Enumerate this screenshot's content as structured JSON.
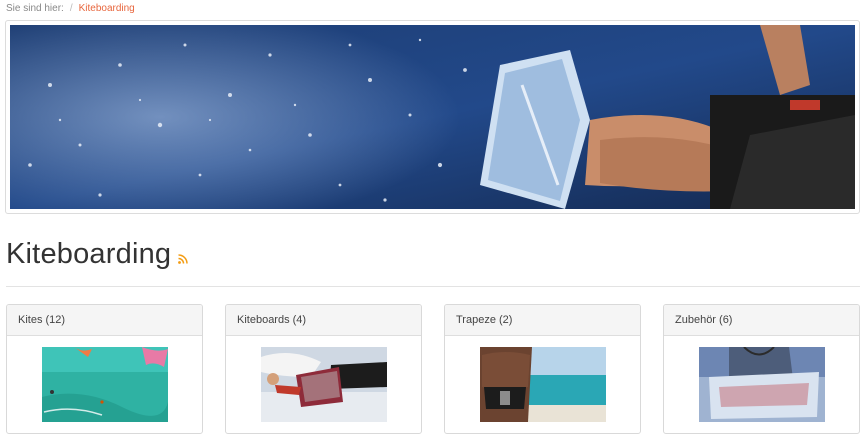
{
  "breadcrumb": {
    "prefix": "Sie sind hier:",
    "separator": "/",
    "current": "Kiteboarding"
  },
  "hero": {
    "image": "kiteboarder-jump-photo"
  },
  "page": {
    "title": "Kiteboarding",
    "feed_icon": "rss-icon"
  },
  "categories": [
    {
      "label": "Kites (12)",
      "image": "kites-photo"
    },
    {
      "label": "Kiteboards (4)",
      "image": "kiteboards-photo"
    },
    {
      "label": "Trapeze (2)",
      "image": "trapeze-photo"
    },
    {
      "label": "Zubehör (6)",
      "image": "zubehoer-photo"
    }
  ],
  "colors": {
    "accent": "#e8663d",
    "rss": "#f39c12"
  }
}
